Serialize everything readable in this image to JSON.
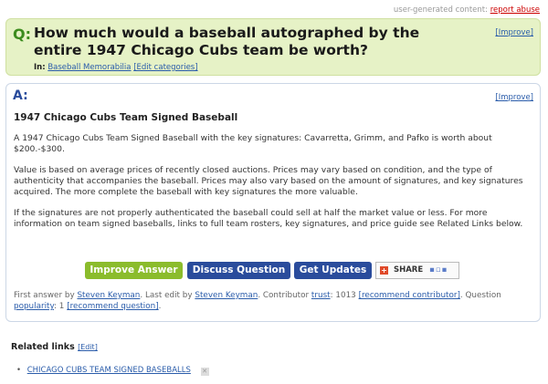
{
  "topbar": {
    "ugc_label": "user-generated content:",
    "report_label": "report abuse"
  },
  "question": {
    "marker": "Q:",
    "title": "How much would a baseball autographed by the entire 1947 Chicago Cubs team be worth?",
    "improve_label": "[Improve]",
    "in_label": "In:",
    "category": "Baseball Memorabilia",
    "edit_categories": "[Edit categories]"
  },
  "answer": {
    "marker": "A:",
    "improve_label": "[Improve]",
    "title": "1947 Chicago Cubs Team Signed Baseball",
    "paragraphs": [
      "A 1947 Chicago Cubs Team Signed Baseball with the key signatures: Cavarretta, Grimm, and Pafko is worth about $200.-$300.",
      "Value is based on average prices of recently closed auctions. Prices may vary based on condition, and the type of authenticity that accompanies the baseball. Prices may also vary based on the amount of signatures, and key signatures acquired. The more complete the baseball with key signatures the more valuable.",
      "If the signatures are not properly authenticated the baseball could sell at half the market value or less. For more information on team signed baseballs, links to full team rosters, key signatures, and price guide see Related Links below."
    ]
  },
  "buttons": {
    "improve": "Improve Answer",
    "discuss": "Discuss Question",
    "updates": "Get Updates",
    "share": "SHARE"
  },
  "credit": {
    "first_answer_by": "First answer by",
    "first_author": "Steven Keyman",
    "last_edit_by": ". Last edit by",
    "last_author": "Steven Keyman",
    "contributor": ". Contributor",
    "trust_label": "trust",
    "trust_value": ": 1013",
    "recommend_contributor": "[recommend contributor]",
    "question_text": ". Question",
    "popularity_label": "popularity",
    "popularity_value": ": 1",
    "recommend_question": "[recommend question]",
    "end": "."
  },
  "related": {
    "title": "Related links",
    "edit": "[Edit]",
    "items": [
      "CHICAGO CUBS TEAM SIGNED BASEBALLS"
    ]
  },
  "colors": {
    "question_bg": "#e6f2c6",
    "green_button": "#8bbc2c",
    "blue_button": "#2a4c9c",
    "link": "#2a5caa"
  }
}
